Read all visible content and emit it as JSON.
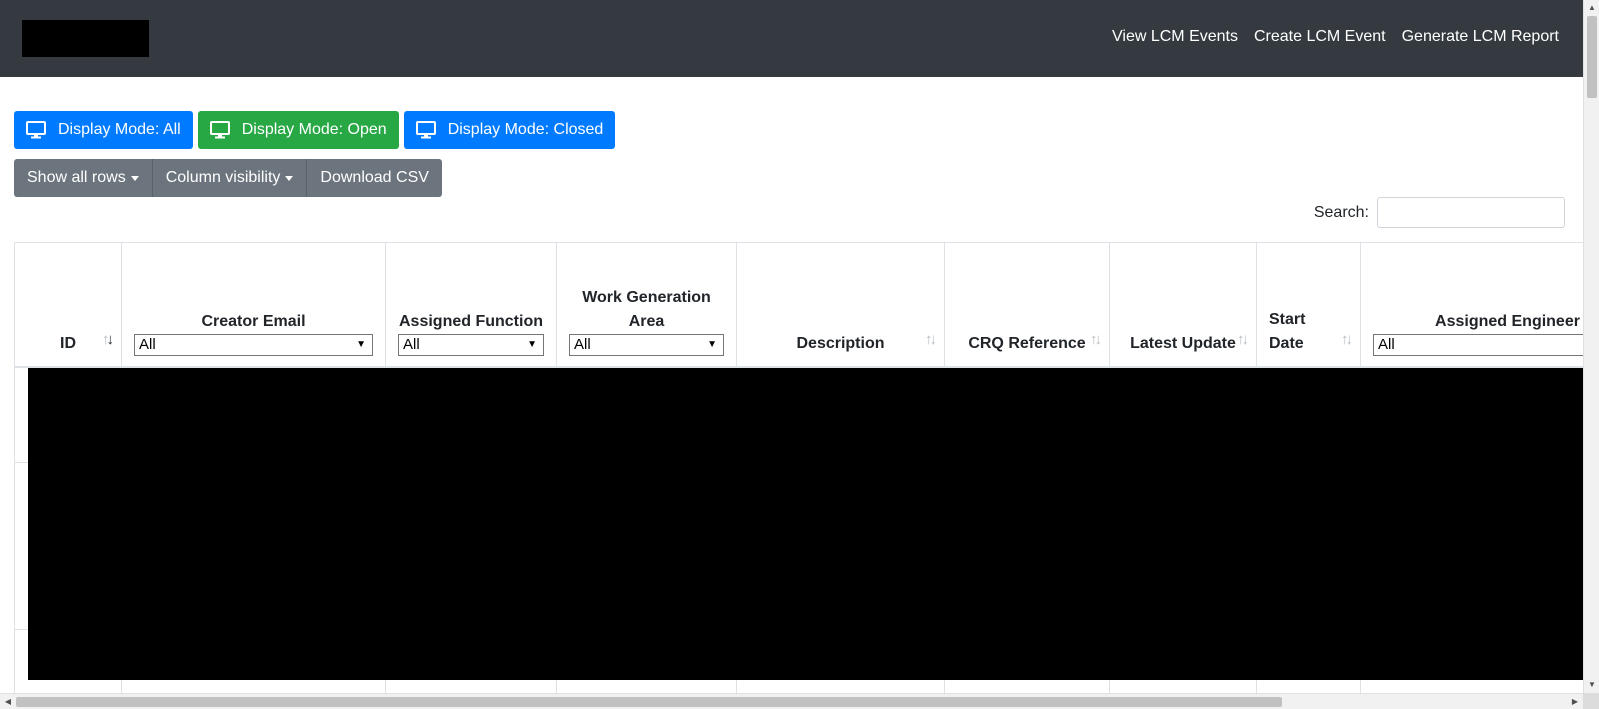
{
  "navbar": {
    "links": [
      "View LCM Events",
      "Create LCM Event",
      "Generate LCM Report"
    ]
  },
  "display_modes": [
    {
      "label": "Display Mode: All",
      "color": "#007bff"
    },
    {
      "label": "Display Mode: Open",
      "color": "#28a745"
    },
    {
      "label": "Display Mode: Closed",
      "color": "#007bff"
    }
  ],
  "table_buttons": {
    "show_rows": "Show all rows",
    "column_visibility": "Column visibility",
    "download_csv": "Download CSV"
  },
  "search": {
    "label": "Search:",
    "value": ""
  },
  "table": {
    "columns": [
      {
        "label": "ID",
        "filter": null,
        "sortable": true
      },
      {
        "label": "Creator Email",
        "filter": "All",
        "sortable": false
      },
      {
        "label": "Assigned Function",
        "filter": "All",
        "sortable": false
      },
      {
        "label": "Work Generation Area",
        "filter": "All",
        "sortable": false
      },
      {
        "label": "Description",
        "filter": null,
        "sortable": true
      },
      {
        "label": "CRQ Reference",
        "filter": null,
        "sortable": true
      },
      {
        "label": "Latest Update",
        "filter": null,
        "sortable": true
      },
      {
        "label": "Start Date",
        "filter": null,
        "sortable": true
      },
      {
        "label": "Assigned Engineer",
        "filter": "All",
        "sortable": false
      }
    ]
  },
  "colors": {
    "navbar_bg": "#343a40",
    "primary": "#007bff",
    "success": "#28a745",
    "secondary": "#6c757d"
  }
}
